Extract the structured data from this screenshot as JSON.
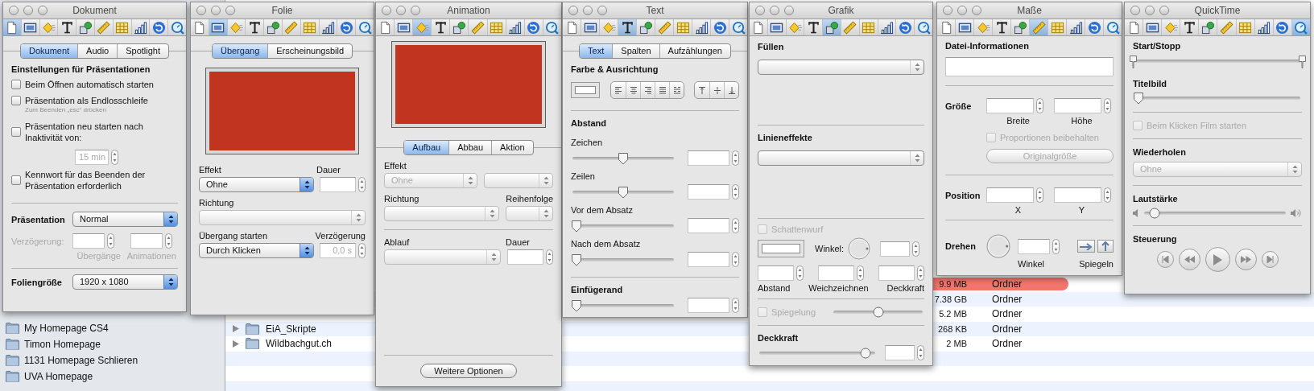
{
  "finder": {
    "sidebar_items": [
      {
        "label": "My Homepage CS4"
      },
      {
        "label": "Timon Homepage"
      },
      {
        "label": "1131 Homepage Schlieren"
      },
      {
        "label": "UVA Homepage"
      }
    ],
    "rows": [
      {
        "size": "9.9 MB",
        "kind": "Ordner",
        "labeled": true
      },
      {
        "size": "7.38 GB",
        "kind": "Ordner",
        "labeled": false
      },
      {
        "size": "5.2 MB",
        "kind": "Ordner",
        "labeled": false
      },
      {
        "name": "EiA_Skripte",
        "size": "268 KB",
        "kind": "Ordner",
        "labeled": false
      },
      {
        "name": "Wildbachgut.ch",
        "size": "2 MB",
        "kind": "Ordner",
        "labeled": false
      }
    ]
  },
  "windows": [
    {
      "kind": "dokument",
      "title": "Dokument",
      "toolbar": [
        {
          "selected": true
        },
        {
          "selected": false
        },
        {
          "selected": false
        },
        {
          "selected": false
        },
        {
          "selected": false
        },
        {
          "selected": false
        },
        {
          "selected": false
        },
        {
          "selected": false
        },
        {
          "selected": false
        },
        {
          "selected": false
        }
      ],
      "tabs": [
        {
          "label": "Dokument",
          "selected": true
        },
        {
          "label": "Audio",
          "selected": false
        },
        {
          "label": "Spotlight",
          "selected": false
        }
      ],
      "heading": "Einstellungen für Präsentationen",
      "options": [
        {
          "label": "Beim Öffnen automatisch starten",
          "checked": false
        },
        {
          "label": "Präsentation als Endlosschleife",
          "checked": false,
          "hint": "Zum Beenden „esc“ drücken"
        },
        {
          "label": "Präsentation neu starten nach Inaktivität von:",
          "checked": false,
          "field": {
            "value": "15 min",
            "disabled": true
          }
        },
        {
          "label": "Kennwort für das Beenden der Präsentation erforderlich",
          "checked": false
        }
      ],
      "presentation": {
        "label": "Präsentation",
        "value": "Normal"
      },
      "delay": {
        "label": "Verzögerung:",
        "disabled": true,
        "captions": [
          "Übergänge",
          "Animationen"
        ]
      },
      "slide_size": {
        "label": "Foliengröße",
        "value": "1920 x 1080"
      }
    },
    {
      "kind": "folie",
      "title": "Folie",
      "toolbar": [
        {
          "selected": false
        },
        {
          "selected": true
        },
        {
          "selected": false
        },
        {
          "selected": false
        },
        {
          "selected": false
        },
        {
          "selected": false
        },
        {
          "selected": false
        },
        {
          "selected": false
        },
        {
          "selected": false
        },
        {
          "selected": false
        }
      ],
      "tabs": [
        {
          "label": "Übergang",
          "selected": true
        },
        {
          "label": "Erscheinungsbild",
          "selected": false
        }
      ],
      "effect": {
        "label": "Effekt",
        "value": "Ohne"
      },
      "duration": {
        "label": "Dauer"
      },
      "direction": {
        "label": "Richtung",
        "disabled": true
      },
      "start": {
        "label": "Übergang starten",
        "value": "Durch Klicken"
      },
      "delay": {
        "label": "Verzögerung",
        "value": "0,0 s",
        "disabled": true
      }
    },
    {
      "kind": "animation",
      "title": "Animation",
      "toolbar": [
        {
          "selected": false
        },
        {
          "selected": false
        },
        {
          "selected": true
        },
        {
          "selected": false
        },
        {
          "selected": false
        },
        {
          "selected": false
        },
        {
          "selected": false
        },
        {
          "selected": false
        },
        {
          "selected": false
        },
        {
          "selected": false
        }
      ],
      "tabs": [
        {
          "label": "Aufbau",
          "selected": true
        },
        {
          "label": "Abbau",
          "selected": false
        },
        {
          "label": "Aktion",
          "selected": false
        }
      ],
      "effect": {
        "label": "Effekt",
        "value": "Ohne",
        "disabled": true
      },
      "direction": {
        "label": "Richtung"
      },
      "order": {
        "label": "Reihenfolge"
      },
      "sequence": {
        "label": "Ablauf"
      },
      "duration": {
        "label": "Dauer"
      },
      "more_button": "Weitere Optionen"
    },
    {
      "kind": "text",
      "title": "Text",
      "toolbar": [
        {
          "selected": false
        },
        {
          "selected": false
        },
        {
          "selected": false
        },
        {
          "selected": true
        },
        {
          "selected": false
        },
        {
          "selected": false
        },
        {
          "selected": false
        },
        {
          "selected": false
        },
        {
          "selected": false
        },
        {
          "selected": false
        }
      ],
      "tabs": [
        {
          "label": "Text",
          "selected": true
        },
        {
          "label": "Spalten",
          "selected": false
        },
        {
          "label": "Aufzählungen",
          "selected": false
        }
      ],
      "color_heading": "Farbe & Ausrichtung",
      "spacing_heading": "Abstand",
      "spacing": [
        {
          "label": "Zeichen",
          "level": 0.5
        },
        {
          "label": "Zeilen",
          "level": 0.5
        },
        {
          "label": "Vor dem Absatz",
          "level": 0
        },
        {
          "label": "Nach dem Absatz",
          "level": 0
        }
      ],
      "inset": {
        "label": "Einfügerand",
        "level": 0
      }
    },
    {
      "kind": "grafik",
      "title": "Grafik",
      "toolbar": [
        {
          "selected": false
        },
        {
          "selected": false
        },
        {
          "selected": false
        },
        {
          "selected": false
        },
        {
          "selected": true
        },
        {
          "selected": false
        },
        {
          "selected": false
        },
        {
          "selected": false
        },
        {
          "selected": false
        },
        {
          "selected": false
        }
      ],
      "fill_heading": "Füllen",
      "line_heading": "Linieneffekte",
      "shadow": {
        "label": "Schattenwurf",
        "checked": false,
        "disabled": true,
        "angle_label": "Winkel:",
        "captions": [
          "Abstand",
          "Weichzeichnen",
          "Deckkraft"
        ]
      },
      "reflection": {
        "label": "Spiegelung",
        "checked": false,
        "disabled": true,
        "level": 0.5
      },
      "opacity": {
        "label": "Deckkraft",
        "level": 0.95
      }
    },
    {
      "kind": "masse",
      "title": "Maße",
      "toolbar": [
        {
          "selected": false
        },
        {
          "selected": false
        },
        {
          "selected": false
        },
        {
          "selected": false
        },
        {
          "selected": false
        },
        {
          "selected": true
        },
        {
          "selected": false
        },
        {
          "selected": false
        },
        {
          "selected": false
        },
        {
          "selected": false
        }
      ],
      "file_heading": "Datei-Informationen",
      "size": {
        "label": "Größe",
        "captions": [
          "Breite",
          "Höhe"
        ]
      },
      "keep_proportions": {
        "label": "Proportionen beibehalten",
        "checked": false,
        "disabled": true
      },
      "original_button": {
        "label": "Originalgröße",
        "disabled": true
      },
      "position": {
        "label": "Position",
        "captions": [
          "X",
          "Y"
        ]
      },
      "rotate": {
        "label": "Drehen",
        "angle_caption": "Winkel",
        "flip_caption": "Spiegeln"
      }
    },
    {
      "kind": "quicktime",
      "title": "QuickTime",
      "toolbar": [
        {
          "selected": false
        },
        {
          "selected": false
        },
        {
          "selected": false
        },
        {
          "selected": false
        },
        {
          "selected": false
        },
        {
          "selected": false
        },
        {
          "selected": false
        },
        {
          "selected": false
        },
        {
          "selected": false
        },
        {
          "selected": true
        }
      ],
      "start_stop": {
        "label": "Start/Stopp",
        "handles": [
          {
            "level": 0
          },
          {
            "level": 1
          }
        ]
      },
      "poster": {
        "label": "Titelbild",
        "level": 0
      },
      "autoplay": {
        "label": "Beim Klicken Film starten",
        "checked": false,
        "disabled": true
      },
      "repeat": {
        "label": "Wiederholen",
        "value": "Ohne",
        "disabled": true
      },
      "volume": {
        "label": "Lautstärke",
        "level": 0.05
      },
      "controls": {
        "label": "Steuerung"
      }
    }
  ]
}
